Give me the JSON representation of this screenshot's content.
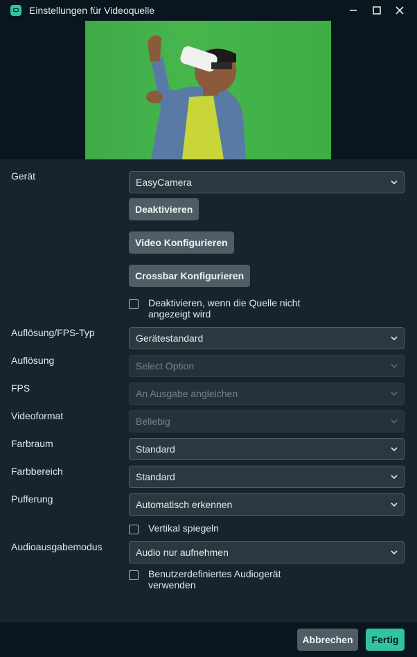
{
  "window": {
    "title": "Einstellungen für Videoquelle",
    "controls": [
      "minimize",
      "maximize",
      "close"
    ]
  },
  "device": {
    "label": "Gerät",
    "value": "EasyCamera",
    "deactivate_button": "Deaktivieren",
    "configure_video_button": "Video Konfigurieren",
    "configure_crossbar_button": "Crossbar Konfigurieren",
    "deactivate_when_hidden_line1": "Deaktivieren, wenn die Quelle nicht",
    "deactivate_when_hidden_line2": "angezeigt wird",
    "deactivate_when_hidden_checked": false
  },
  "fields": {
    "res_fps_type": {
      "label": "Auflösung/FPS-Typ",
      "value": "Gerätestandard"
    },
    "resolution": {
      "label": "Auflösung",
      "placeholder": "Select Option"
    },
    "fps": {
      "label": "FPS",
      "value": "An Ausgabe angleichen"
    },
    "video_format": {
      "label": "Videoformat",
      "value": "Beliebig"
    },
    "color_space": {
      "label": "Farbraum",
      "value": "Standard"
    },
    "color_range": {
      "label": "Farbbereich",
      "value": "Standard"
    },
    "buffering": {
      "label": "Pufferung",
      "value": "Automatisch erkennen"
    },
    "flip_vertical": {
      "label": "Vertikal spiegeln",
      "checked": false
    },
    "audio_output_mode": {
      "label": "Audioausgabemodus",
      "value": "Audio nur aufnehmen"
    },
    "custom_audio": {
      "line1": "Benutzerdefiniertes Audiogerät",
      "line2": "verwenden",
      "checked": false
    }
  },
  "footer": {
    "cancel_label": "Abbrechen",
    "done_label": "Fertig"
  },
  "colors": {
    "background": "#17242d",
    "titlebar": "#09161d",
    "accent": "#31c3a2",
    "button": "#4f5e65"
  }
}
